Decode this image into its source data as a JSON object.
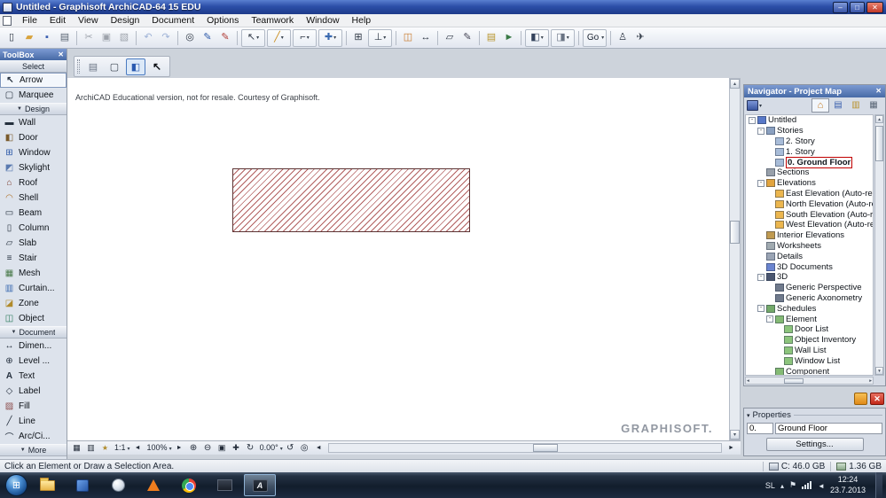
{
  "window": {
    "title": "Untitled - Graphisoft ArchiCAD-64 15 EDU"
  },
  "menu": {
    "items": [
      "File",
      "Edit",
      "View",
      "Design",
      "Document",
      "Options",
      "Teamwork",
      "Window",
      "Help"
    ]
  },
  "toolbar": {
    "items": [
      {
        "kind": "btn",
        "name": "new-document-icon"
      },
      {
        "kind": "btn",
        "name": "open-icon"
      },
      {
        "kind": "btn",
        "name": "save-icon"
      },
      {
        "kind": "btn",
        "name": "print-icon"
      },
      {
        "kind": "sep",
        "name": "separator"
      },
      {
        "kind": "btn",
        "name": "cut-icon",
        "state": "disabled"
      },
      {
        "kind": "btn",
        "name": "copy-icon",
        "state": "disabled"
      },
      {
        "kind": "btn",
        "name": "paste-icon",
        "state": "disabled"
      },
      {
        "kind": "sep",
        "name": "separator"
      },
      {
        "kind": "btn",
        "name": "undo-icon",
        "state": "disabled"
      },
      {
        "kind": "btn",
        "name": "redo-icon",
        "state": "disabled"
      },
      {
        "kind": "sep",
        "name": "separator"
      },
      {
        "kind": "btn",
        "name": "find-select-icon"
      },
      {
        "kind": "btn",
        "name": "pen-icon"
      },
      {
        "kind": "btn",
        "name": "marker-icon"
      },
      {
        "kind": "sep",
        "name": "separator"
      },
      {
        "kind": "btn",
        "name": "selection-options-dropdown",
        "caret": "▾"
      },
      {
        "kind": "btn",
        "name": "guide-lines-dropdown",
        "caret": "▾"
      },
      {
        "kind": "btn",
        "name": "snap-options-dropdown",
        "caret": "▾"
      },
      {
        "kind": "btn",
        "name": "coordinates-dropdown",
        "caret": "▾"
      },
      {
        "kind": "sep",
        "name": "separator"
      },
      {
        "kind": "btn",
        "name": "grid-icon"
      },
      {
        "kind": "btn",
        "name": "gravity-dropdown",
        "caret": "▾"
      },
      {
        "kind": "sep",
        "name": "separator"
      },
      {
        "kind": "btn",
        "name": "trace-reference-icon"
      },
      {
        "kind": "btn",
        "name": "dimension-icon"
      },
      {
        "kind": "sep",
        "name": "separator"
      },
      {
        "kind": "btn",
        "name": "element-transform-icon"
      },
      {
        "kind": "btn",
        "name": "modify-icon"
      },
      {
        "kind": "sep",
        "name": "separator"
      },
      {
        "kind": "btn",
        "name": "layouts-icon"
      },
      {
        "kind": "btn",
        "name": "publish-icon"
      },
      {
        "kind": "sep",
        "name": "separator"
      },
      {
        "kind": "btn",
        "name": "three-d-view-dropdown",
        "caret": "▾"
      },
      {
        "kind": "btn",
        "name": "rendering-dropdown",
        "caret": "▾"
      },
      {
        "kind": "sep",
        "name": "separator"
      },
      {
        "kind": "btn",
        "name": "go-menu-dropdown",
        "label": "Go",
        "caret": "▾"
      },
      {
        "kind": "sep",
        "name": "separator"
      },
      {
        "kind": "btn",
        "name": "walk-mode-icon"
      },
      {
        "kind": "btn",
        "name": "fly-mode-icon"
      }
    ]
  },
  "toolbox": {
    "title": "ToolBox",
    "rows": [
      {
        "type": "header",
        "label": "Select"
      },
      {
        "type": "item",
        "label": "Arrow",
        "icon": "arrow-tool-icon",
        "state": "active"
      },
      {
        "type": "item",
        "label": "Marquee",
        "icon": "marquee-tool-icon"
      },
      {
        "type": "header",
        "label": "Design",
        "caret": "▼"
      },
      {
        "type": "item",
        "label": "Wall",
        "icon": "wall-tool-icon"
      },
      {
        "type": "item",
        "label": "Door",
        "icon": "door-tool-icon"
      },
      {
        "type": "item",
        "label": "Window",
        "icon": "window-tool-icon"
      },
      {
        "type": "item",
        "label": "Skylight",
        "icon": "skylight-tool-icon"
      },
      {
        "type": "item",
        "label": "Roof",
        "icon": "roof-tool-icon"
      },
      {
        "type": "item",
        "label": "Shell",
        "icon": "shell-tool-icon"
      },
      {
        "type": "item",
        "label": "Beam",
        "icon": "beam-tool-icon"
      },
      {
        "type": "item",
        "label": "Column",
        "icon": "column-tool-icon"
      },
      {
        "type": "item",
        "label": "Slab",
        "icon": "slab-tool-icon"
      },
      {
        "type": "item",
        "label": "Stair",
        "icon": "stair-tool-icon"
      },
      {
        "type": "item",
        "label": "Mesh",
        "icon": "mesh-tool-icon"
      },
      {
        "type": "item",
        "label": "Curtain...",
        "icon": "curtain-wall-tool-icon"
      },
      {
        "type": "item",
        "label": "Zone",
        "icon": "zone-tool-icon"
      },
      {
        "type": "item",
        "label": "Object",
        "icon": "object-tool-icon"
      },
      {
        "type": "header",
        "label": "Document",
        "caret": "▼"
      },
      {
        "type": "item",
        "label": "Dimen...",
        "icon": "dimension-tool-icon"
      },
      {
        "type": "item",
        "label": "Level ...",
        "icon": "level-dimension-tool-icon"
      },
      {
        "type": "item",
        "label": "Text",
        "icon": "text-tool-icon"
      },
      {
        "type": "item",
        "label": "Label",
        "icon": "label-tool-icon"
      },
      {
        "type": "item",
        "label": "Fill",
        "icon": "fill-tool-icon"
      },
      {
        "type": "item",
        "label": "Line",
        "icon": "line-tool-icon"
      },
      {
        "type": "item",
        "label": "Arc/Ci...",
        "icon": "arc-tool-icon"
      },
      {
        "type": "header",
        "label": "More",
        "caret": "▼"
      }
    ]
  },
  "canvas": {
    "edu_notice": "ArchiCAD Educational version, not for resale. Courtesy of Graphisoft.",
    "watermark": "GRAPHISOFT."
  },
  "bottombar": {
    "scale": "1:1",
    "zoom": "100%",
    "angle": "0.00°"
  },
  "navigator": {
    "title": "Navigator - Project Map",
    "tree": [
      {
        "label": "Untitled",
        "level": 0,
        "expander": "-",
        "icon": "project-icon"
      },
      {
        "label": "Stories",
        "level": 1,
        "expander": "-",
        "icon": "stories-icon"
      },
      {
        "label": "2. Story",
        "level": 2,
        "icon": "story-icon"
      },
      {
        "label": "1. Story",
        "level": 2,
        "icon": "story-icon"
      },
      {
        "label": "0. Ground Floor",
        "level": 2,
        "icon": "story-icon",
        "state": "selected"
      },
      {
        "label": "Sections",
        "level": 1,
        "icon": "sections-icon"
      },
      {
        "label": "Elevations",
        "level": 1,
        "expander": "-",
        "icon": "elevations-icon"
      },
      {
        "label": "East Elevation (Auto-reb...",
        "level": 2,
        "icon": "elevation-icon"
      },
      {
        "label": "North Elevation (Auto-reb...",
        "level": 2,
        "icon": "elevation-icon"
      },
      {
        "label": "South Elevation (Auto-reb...",
        "level": 2,
        "icon": "elevation-icon"
      },
      {
        "label": "West Elevation (Auto-reb...",
        "level": 2,
        "icon": "elevation-icon"
      },
      {
        "label": "Interior Elevations",
        "level": 1,
        "icon": "interior-elevations-icon"
      },
      {
        "label": "Worksheets",
        "level": 1,
        "icon": "worksheets-icon"
      },
      {
        "label": "Details",
        "level": 1,
        "icon": "details-icon"
      },
      {
        "label": "3D Documents",
        "level": 1,
        "icon": "three-d-documents-icon"
      },
      {
        "label": "3D",
        "level": 1,
        "expander": "-",
        "icon": "three-d-icon"
      },
      {
        "label": "Generic Perspective",
        "level": 2,
        "icon": "perspective-icon"
      },
      {
        "label": "Generic Axonometry",
        "level": 2,
        "icon": "axonometry-icon"
      },
      {
        "label": "Schedules",
        "level": 1,
        "expander": "-",
        "icon": "schedules-icon"
      },
      {
        "label": "Element",
        "level": 2,
        "expander": "-",
        "icon": "element-schedule-icon"
      },
      {
        "label": "Door List",
        "level": 3,
        "icon": "schedule-list-icon"
      },
      {
        "label": "Object Inventory",
        "level": 3,
        "icon": "schedule-list-icon"
      },
      {
        "label": "Wall List",
        "level": 3,
        "icon": "schedule-list-icon"
      },
      {
        "label": "Window List",
        "level": 3,
        "icon": "schedule-list-icon"
      },
      {
        "label": "Component",
        "level": 2,
        "icon": "component-schedule-icon"
      }
    ]
  },
  "properties": {
    "header": "Properties",
    "story_number": "0.",
    "story_name": "Ground Floor",
    "settings_label": "Settings..."
  },
  "statusbar": {
    "message": "Click an Element or Draw a Selection Area.",
    "disk": "C: 46.0 GB",
    "memory": "1.36 GB"
  },
  "taskbar": {
    "language": "SL",
    "time": "12:24",
    "date": "23.7.2013",
    "buttons": [
      {
        "name": "explorer-icon"
      },
      {
        "name": "windows-app-icon"
      },
      {
        "name": "media-player-icon"
      },
      {
        "name": "vlc-icon"
      },
      {
        "name": "chrome-icon"
      },
      {
        "name": "archicad-window-icon"
      },
      {
        "name": "archicad-icon",
        "state": "active"
      }
    ]
  },
  "colors": {
    "titlebar_blue": "#2c4fa8",
    "navigator_header_blue": "#476aa6",
    "hatch_red": "#b26060",
    "selection_red": "#c00000",
    "taskbar_dark": "#121d2c"
  }
}
